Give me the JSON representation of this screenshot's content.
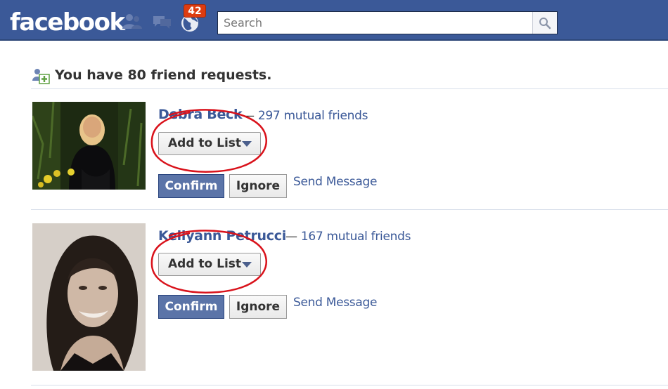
{
  "header": {
    "logo_text": "facebook",
    "notifications_count": "42",
    "search_placeholder": "Search",
    "brand_color": "#3b5998",
    "badge_color": "#dd3c10",
    "icons": [
      "friend-requests-icon",
      "messages-icon",
      "notifications-globe-icon",
      "search-icon"
    ]
  },
  "requests": {
    "summary_text": "You have 80 friend requests.",
    "items": [
      {
        "name": "Debra Beck",
        "separator": "—",
        "mutual_text": "297 mutual friends",
        "add_to_list_label": "Add to List",
        "confirm_label": "Confirm",
        "ignore_label": "Ignore",
        "send_message_label": "Send Message"
      },
      {
        "name": "Kellyann Petrucci",
        "separator": "—",
        "mutual_text": "167 mutual friends",
        "add_to_list_label": "Add to List",
        "confirm_label": "Confirm",
        "ignore_label": "Ignore",
        "send_message_label": "Send Message"
      }
    ]
  },
  "annotation": {
    "highlight_color": "#d9121b"
  }
}
